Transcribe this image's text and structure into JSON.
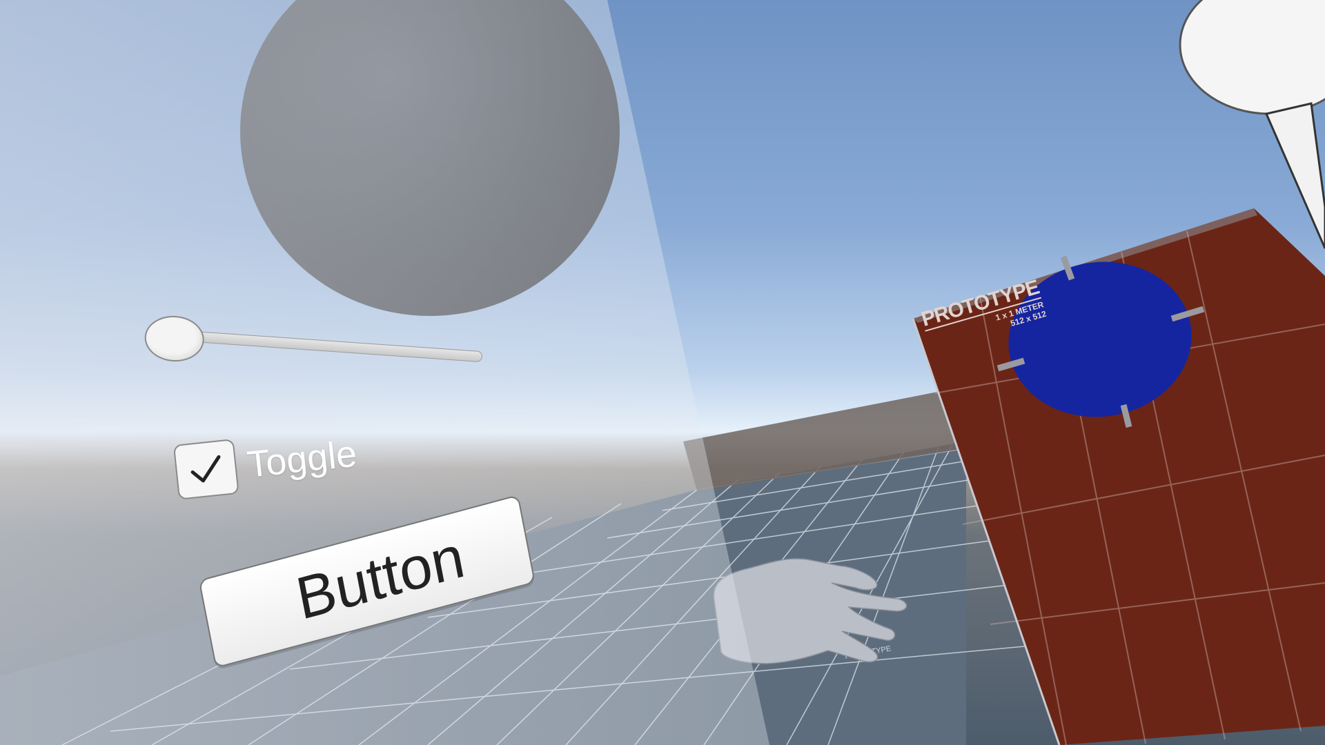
{
  "scene": {
    "colors": {
      "sky_top": "#6f93c4",
      "sky_horizon": "#e6f1fb",
      "floor": "#5c6c7c",
      "grid_line": "#e8eef4",
      "sphere": "#3c3f45",
      "wall": "#6b2516",
      "target": "#1525a0",
      "hand": "#b8bdc6",
      "lamp": "#f5f5f5"
    },
    "icons": [
      "sphere",
      "hand",
      "lamp",
      "target"
    ]
  },
  "ui_panel": {
    "slider": {
      "value": 0.0
    },
    "toggle": {
      "label": "Toggle",
      "checked": true,
      "icon": "check-icon"
    },
    "button": {
      "label": "Button"
    }
  },
  "wall_texture": {
    "title": "PROTOTYPE",
    "size_line": "1 x 1 METER",
    "res_line": "512 x 512"
  },
  "floor_texture": {
    "label": "PROTOTYPE"
  }
}
